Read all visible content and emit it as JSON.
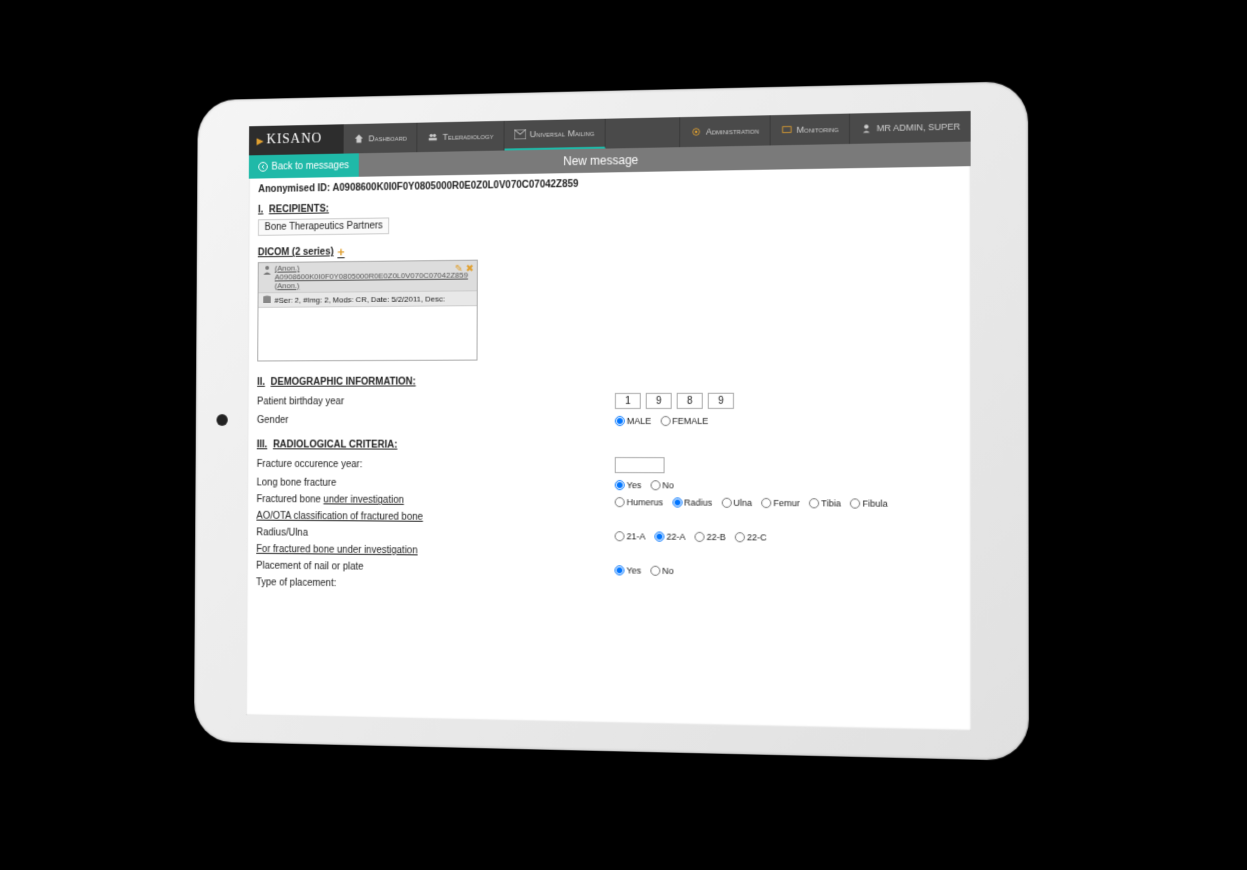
{
  "brand": "KISANO",
  "nav": {
    "dashboard": "Dashboard",
    "teleradiology": "Teleradiology",
    "universal_mailing": "Universal Mailing",
    "administration": "Administration",
    "monitoring": "Monitoring",
    "user": "MR ADMIN, SUPER"
  },
  "back_label": "Back to messages",
  "page_title": "New message",
  "anon_label": "Anonymised ID: ",
  "anon_id": "A0908600K0I0F0Y0805000R0E0Z0L0V070C07042Z859",
  "sections": {
    "recipients_num": "I.",
    "recipients": "RECIPIENTS:",
    "demo_num": "II.",
    "demo": "DEMOGRAPHIC INFORMATION:",
    "radio_num": "III.",
    "radio": "RADIOLOGICAL CRITERIA:"
  },
  "recipient_chip": "Bone Therapeutics Partners",
  "dicom": {
    "heading": "DICOM (2 series)",
    "anon1": "(Anon.)",
    "link": "A0908600K0I0F0Y0805000R0E0Z0L0V070C07042Z859",
    "anon2": "(Anon.)",
    "meta": "#Ser: 2, #Img: 2, Mods: CR, Date: 5/2/2011, Desc:"
  },
  "demo_fields": {
    "birth_label": "Patient birthday year",
    "birth_digits": [
      "1",
      "9",
      "8",
      "9"
    ],
    "gender_label": "Gender",
    "gender_options": {
      "male": "MALE",
      "female": "FEMALE"
    }
  },
  "rad_fields": {
    "fracture_year_label": "Fracture occurence year:",
    "long_bone_label": "Long bone fracture",
    "yes": "Yes",
    "no": "No",
    "fractured_bone_label_a": "Fractured bone ",
    "fractured_bone_label_b": "under investigation",
    "bones": [
      "Humerus",
      "Radius",
      "Ulna",
      "Femur",
      "Tibia",
      "Fibula"
    ],
    "selected_bone": "Radius",
    "ao_label": "AO/OTA classification of fractured bone",
    "radius_ulna_label": "Radius/Ulna",
    "ao_options": [
      "21-A",
      "22-A",
      "22-B",
      "22-C"
    ],
    "selected_ao": "22-A",
    "for_fractured_label": "For fractured bone under investigation",
    "placement_label": "Placement of nail or plate",
    "type_placement_label": "Type of placement:"
  }
}
